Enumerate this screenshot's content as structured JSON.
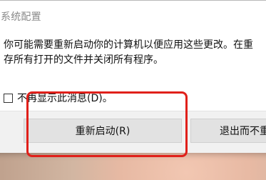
{
  "dialog": {
    "title": "系统配置",
    "message_line1": "你可能需要重新启动你的计算机以便应用这些更改。在重",
    "message_line2": "存所有打开的文件并关闭所有程序。",
    "checkbox_label": "不再显示此消息(D)。",
    "checkbox_checked": false,
    "buttons": {
      "restart": "重新启动(R)",
      "exit": "退出而不重"
    }
  },
  "annotation": {
    "highlight_color": "#e0201a"
  }
}
